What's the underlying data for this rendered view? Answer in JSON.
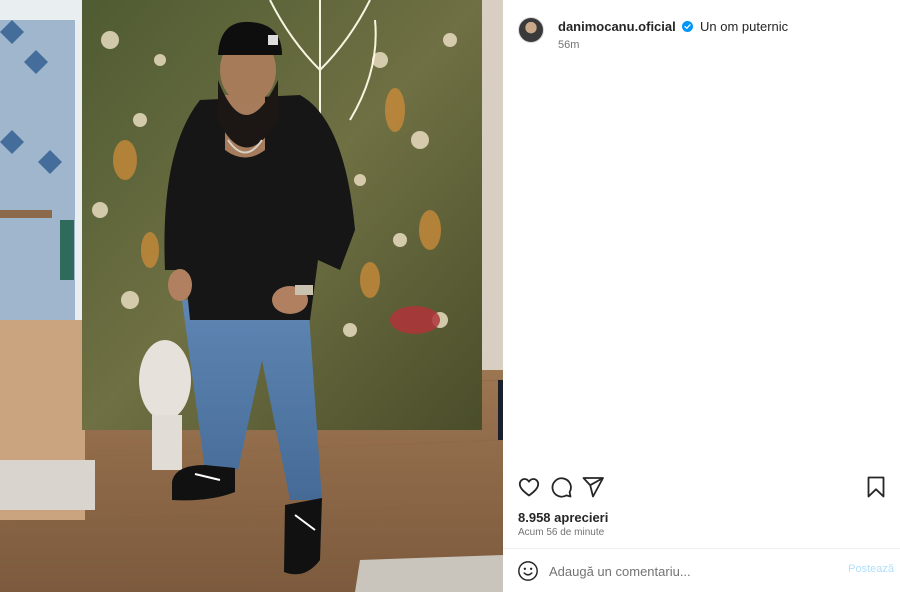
{
  "post": {
    "image_alt": "Man in black shirt and jeans standing before a flower wall",
    "username": "danimocanu.oficial",
    "verified": true,
    "caption": "Un om puternic",
    "time": "56m",
    "likes": "8.958 aprecieri",
    "time_ago": "Acum 56 de minute"
  },
  "icons": {
    "verified": "verified-badge-icon",
    "like": "heart-icon",
    "comment": "comment-icon",
    "share": "paper-plane-icon",
    "save": "bookmark-icon",
    "emoji": "smiley-icon"
  },
  "comment": {
    "placeholder": "Adaugă un comentariu...",
    "post_label": "Postează"
  },
  "colors": {
    "verified_blue": "#0095f6",
    "post_button_disabled": "#b2dffc",
    "text_primary": "#262626",
    "text_secondary": "#737373"
  }
}
